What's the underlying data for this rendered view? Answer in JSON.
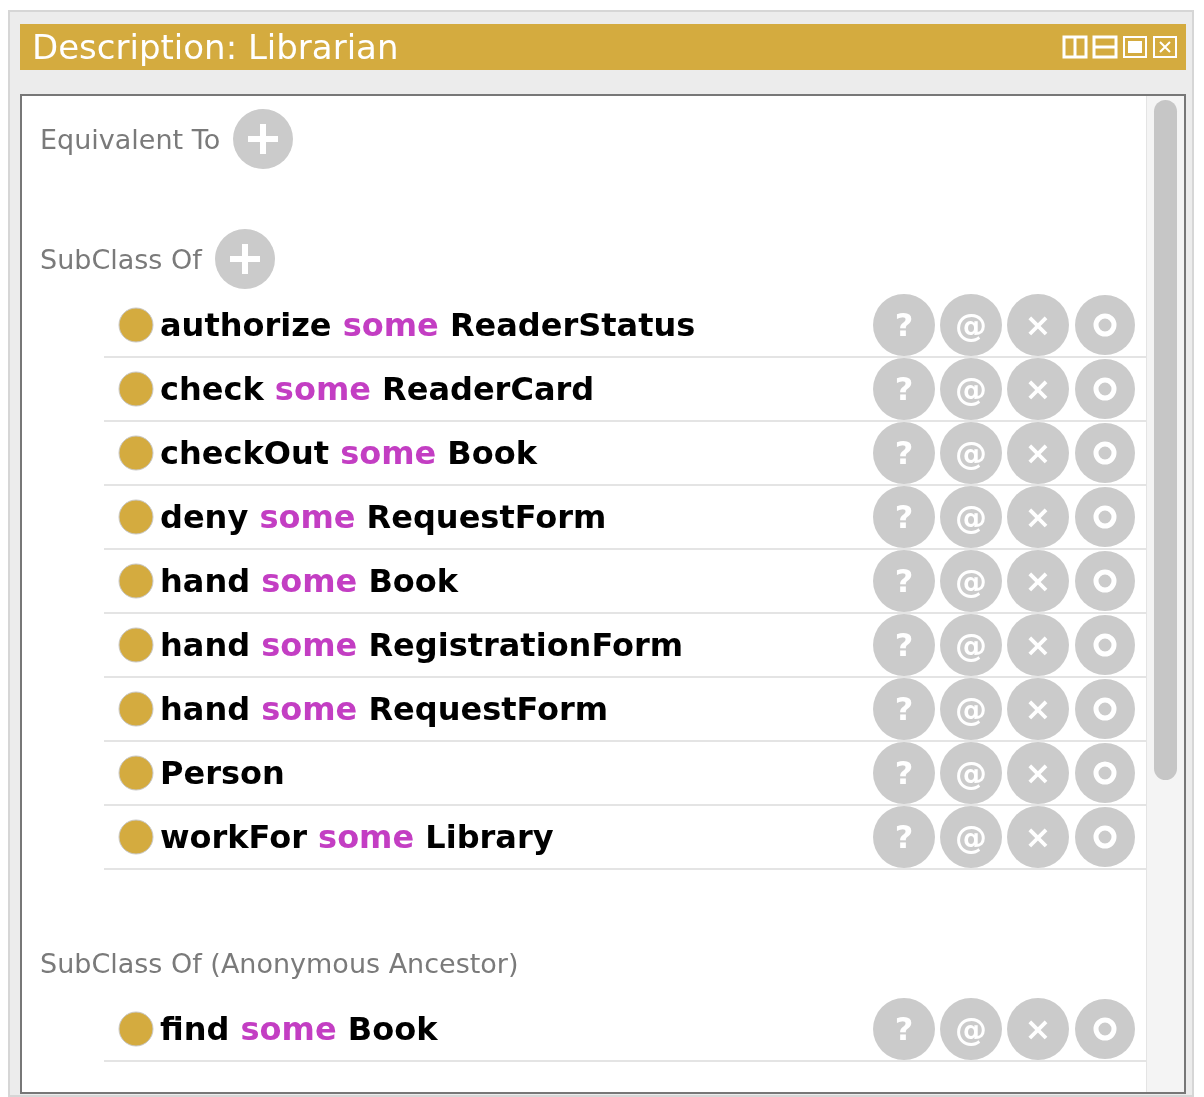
{
  "window": {
    "title": "Description: Librarian"
  },
  "sections": [
    {
      "title": "Equivalent To",
      "add_button": true
    },
    {
      "title": "SubClass Of",
      "add_button": true,
      "rows": [
        {
          "parts": [
            {
              "text": "authorize",
              "kind": "entity"
            },
            {
              "text": "some",
              "kind": "keyword"
            },
            {
              "text": "ReaderStatus",
              "kind": "entity"
            }
          ],
          "actions": [
            "?",
            "@",
            "×"
          ]
        },
        {
          "parts": [
            {
              "text": "check",
              "kind": "entity"
            },
            {
              "text": "some",
              "kind": "keyword"
            },
            {
              "text": "ReaderCard",
              "kind": "entity"
            }
          ],
          "actions": [
            "?",
            "@",
            "×"
          ]
        },
        {
          "parts": [
            {
              "text": "checkOut",
              "kind": "entity"
            },
            {
              "text": "some",
              "kind": "keyword"
            },
            {
              "text": "Book",
              "kind": "entity"
            }
          ],
          "actions": [
            "?",
            "@",
            "×"
          ]
        },
        {
          "parts": [
            {
              "text": "deny",
              "kind": "entity"
            },
            {
              "text": "some",
              "kind": "keyword"
            },
            {
              "text": "RequestForm",
              "kind": "entity"
            }
          ],
          "actions": [
            "?",
            "@",
            "×"
          ]
        },
        {
          "parts": [
            {
              "text": "hand",
              "kind": "entity"
            },
            {
              "text": "some",
              "kind": "keyword"
            },
            {
              "text": "Book",
              "kind": "entity"
            }
          ],
          "actions": [
            "?",
            "@",
            "×"
          ]
        },
        {
          "parts": [
            {
              "text": "hand",
              "kind": "entity"
            },
            {
              "text": "some",
              "kind": "keyword"
            },
            {
              "text": "RegistrationForm",
              "kind": "entity"
            }
          ],
          "actions": [
            "?",
            "@",
            "×"
          ]
        },
        {
          "parts": [
            {
              "text": "hand",
              "kind": "entity"
            },
            {
              "text": "some",
              "kind": "keyword"
            },
            {
              "text": "RequestForm",
              "kind": "entity"
            }
          ],
          "actions": [
            "?",
            "@",
            "×"
          ]
        },
        {
          "parts": [
            {
              "text": "Person",
              "kind": "entity"
            }
          ],
          "actions": [
            "?",
            "@",
            "×"
          ]
        },
        {
          "parts": [
            {
              "text": "workFor",
              "kind": "entity"
            },
            {
              "text": "some",
              "kind": "keyword"
            },
            {
              "text": "Library",
              "kind": "entity"
            }
          ],
          "actions": [
            "?",
            "@",
            "×"
          ]
        }
      ]
    },
    {
      "title": "SubClass Of (Anonymous Ancestor)",
      "add_button": false,
      "rows": [
        {
          "parts": [
            {
              "text": "find",
              "kind": "entity"
            },
            {
              "text": "some",
              "kind": "keyword"
            },
            {
              "text": "Book",
              "kind": "entity"
            }
          ],
          "actions": [
            "?",
            "@",
            "×"
          ]
        }
      ]
    }
  ]
}
